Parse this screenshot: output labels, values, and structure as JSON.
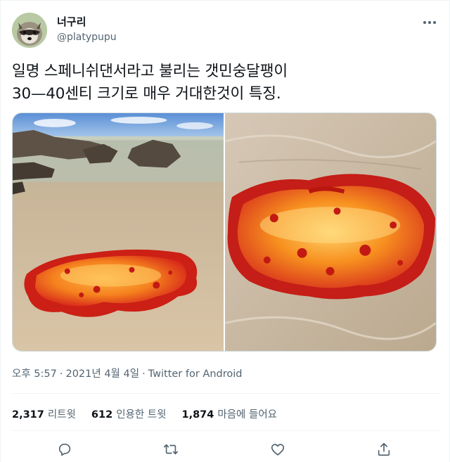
{
  "user": {
    "display_name": "너구리",
    "handle": "@platypupu",
    "avatar": "raccoon-avatar"
  },
  "tweet": {
    "text": "일명 스페니쉬댄서라고 불리는 갯민숭달팽이\n30—40센티 크기로 매우 거대한것이 특징.",
    "photos": [
      "spanish-dancer-beach-photo",
      "spanish-dancer-closeup-photo"
    ]
  },
  "meta": {
    "time": "오후 5:57",
    "dot": "·",
    "date": "2021년 4월 4일",
    "source": "Twitter for Android"
  },
  "stats": {
    "retweets_count": "2,317",
    "retweets_label": "리트윗",
    "quotes_count": "612",
    "quotes_label": "인용한 트윗",
    "likes_count": "1,874",
    "likes_label": "마음에 들어요"
  },
  "colors": {
    "text": "#0f1419",
    "muted": "#536471",
    "divider": "#eff3f4",
    "slug_red": "#d9261c",
    "slug_orange": "#f7821d"
  },
  "icons": [
    "more-icon",
    "reply-icon",
    "retweet-icon",
    "like-icon",
    "share-icon"
  ]
}
